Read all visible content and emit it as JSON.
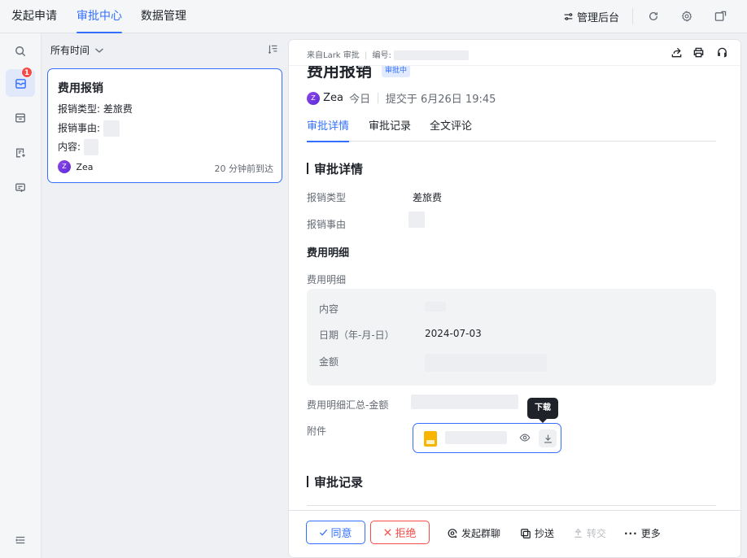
{
  "topbar": {
    "tabs": [
      {
        "label": "发起申请"
      },
      {
        "label": "审批中心"
      },
      {
        "label": "数据管理"
      }
    ],
    "admin_label": "管理后台",
    "accent": "#3370ff"
  },
  "rail": {
    "badge_count": "1",
    "icons": [
      "search-icon",
      "inbox-icon",
      "archive-icon",
      "document-icon",
      "forward-icon",
      "collapse-icon"
    ]
  },
  "list": {
    "filter_label": "所有时间",
    "card": {
      "title": "费用报销",
      "type_label": "报销类型:",
      "type_value": "差旅费",
      "reason_label": "报销事由:",
      "content_label": "内容:",
      "avatar_letter": "Z",
      "user": "Zea",
      "time": "20 分钟前到达"
    }
  },
  "detail": {
    "header": {
      "source": "来自Lark 审批",
      "number_label": "编号:"
    },
    "title": "费用报销",
    "status": "审批中",
    "submitter": {
      "avatar_letter": "Z",
      "name": "Zea",
      "day": "今日",
      "submitted": "提交于 6月26日 19:45"
    },
    "tabs": [
      {
        "label": "审批详情"
      },
      {
        "label": "审批记录"
      },
      {
        "label": "全文评论"
      }
    ],
    "section_title": "审批详情",
    "fields": {
      "type_label": "报销类型",
      "type_value": "差旅费",
      "reason_label": "报销事由"
    },
    "expense": {
      "heading": "费用明细",
      "label": "费用明细",
      "content_label": "内容",
      "date_label": "日期（年-月-日）",
      "date_value": "2024-07-03",
      "amount_label": "金额"
    },
    "total_label": "费用明细汇总-金额",
    "attachment_label": "附件",
    "tooltip": "下载",
    "record_title": "审批记录",
    "footer": {
      "approve": "同意",
      "reject": "拒绝",
      "group_chat": "发起群聊",
      "cc": "抄送",
      "transfer": "转交",
      "more": "更多"
    }
  }
}
